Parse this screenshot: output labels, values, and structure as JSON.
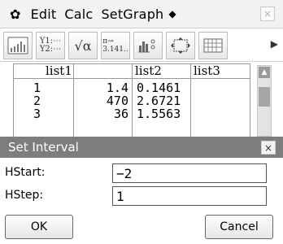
{
  "menubar": {
    "gear_icon": "gear-icon",
    "items": [
      "Edit",
      "Calc",
      "SetGraph"
    ],
    "more_marker": "◆",
    "close_symbol": "×"
  },
  "toolbar": {
    "buttons": [
      {
        "icon": "graph-window-icon"
      },
      {
        "icon": "list-editor-y-icon",
        "text": "Y1:\nY2:"
      },
      {
        "icon": "sqrt-alpha-icon",
        "text": "√α"
      },
      {
        "icon": "pi-decimal-icon",
        "text": "π→ 3.141.."
      },
      {
        "icon": "stat-graph-icon"
      },
      {
        "icon": "resize-window-icon"
      },
      {
        "icon": "keyboard-grid-icon"
      }
    ],
    "next_arrow": "▶"
  },
  "table": {
    "headers": [
      "list1",
      "list2",
      "list3"
    ],
    "rows": [
      {
        "num": "1",
        "list1": "1.4",
        "list2": "0.1461",
        "list3": ""
      },
      {
        "num": "2",
        "list1": "470",
        "list2": "2.6721",
        "list3": ""
      },
      {
        "num": "3",
        "list1": "36",
        "list2": "1.5563",
        "list3": ""
      }
    ]
  },
  "dialog": {
    "title": "Set Interval",
    "close_symbol": "×",
    "fields": [
      {
        "label": "HStart:",
        "value": "−2"
      },
      {
        "label": "HStep:",
        "value": "1"
      }
    ],
    "ok_label": "OK",
    "cancel_label": "Cancel"
  }
}
